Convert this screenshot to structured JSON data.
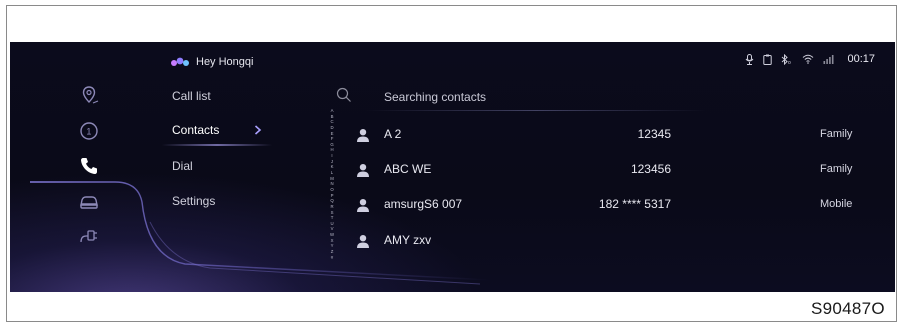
{
  "assistant": {
    "label": "Hey Hongqi"
  },
  "status": {
    "time": "00:17",
    "icons": [
      "microphone-icon",
      "clipboard-icon",
      "bluetooth-icon",
      "wifi-icon",
      "signal-icon"
    ]
  },
  "side_icons": [
    "navigation-icon",
    "media-icon",
    "phone-icon",
    "car-icon",
    "charging-icon"
  ],
  "menu": {
    "items": [
      {
        "label": "Call list"
      },
      {
        "label": "Contacts"
      },
      {
        "label": "Dial"
      },
      {
        "label": "Settings"
      }
    ],
    "active": "Contacts"
  },
  "search": {
    "placeholder": "Searching contacts"
  },
  "alphabet": [
    "A",
    "B",
    "C",
    "D",
    "E",
    "F",
    "G",
    "H",
    "I",
    "J",
    "K",
    "L",
    "M",
    "N",
    "O",
    "P",
    "Q",
    "R",
    "S",
    "T",
    "U",
    "V",
    "W",
    "X",
    "Y",
    "Z",
    "#"
  ],
  "contacts": [
    {
      "name": "A 2",
      "number": "12345",
      "type": "Family"
    },
    {
      "name": "ABC WE",
      "number": "123456",
      "type": "Family"
    },
    {
      "name": "amsurgS6 007",
      "number": "182 **** 5317",
      "type": "Mobile"
    },
    {
      "name": "AMY zxv",
      "number": "",
      "type": ""
    }
  ],
  "figure_id": "S90487O",
  "colors": {
    "background": "#0b0b1c",
    "accent": "#7a70d8",
    "text": "#e9e9f1"
  }
}
